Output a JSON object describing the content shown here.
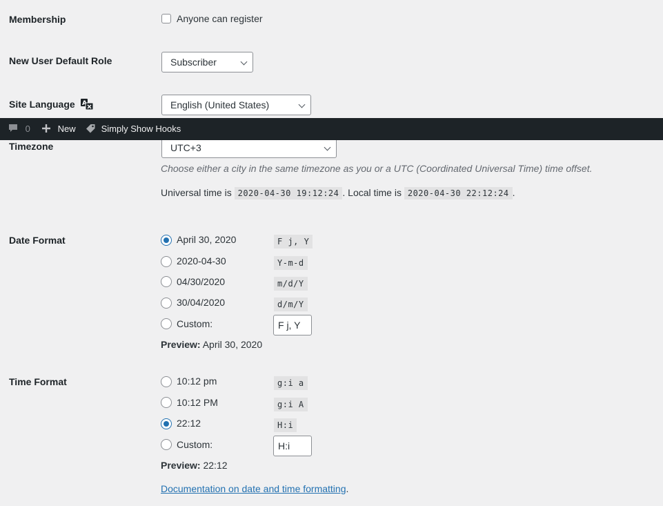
{
  "membership": {
    "label": "Membership",
    "checkbox_label": "Anyone can register",
    "checked": false
  },
  "default_role": {
    "label": "New User Default Role",
    "value": "Subscriber"
  },
  "site_language": {
    "label": "Site Language",
    "value": "English (United States)",
    "icon": "translation-icon"
  },
  "admin_bar": {
    "comments_count": "0",
    "new_label": "New",
    "plugin_label": "Simply Show Hooks",
    "icons": [
      "comment-icon",
      "plus-icon",
      "tag-icon"
    ]
  },
  "timezone": {
    "label": "Timezone",
    "value": "UTC+3",
    "description": "Choose either a city in the same timezone as you or a UTC (Coordinated Universal Time) time offset.",
    "universal_prefix": "Universal time is",
    "universal_value": "2020-04-30 19:12:24",
    "local_prefix": ". Local time is",
    "local_value": "2020-04-30 22:12:24",
    "suffix": "."
  },
  "date_format": {
    "label": "Date Format",
    "options": [
      {
        "label": "April 30, 2020",
        "code": "F j, Y",
        "checked": true
      },
      {
        "label": "2020-04-30",
        "code": "Y-m-d",
        "checked": false
      },
      {
        "label": "04/30/2020",
        "code": "m/d/Y",
        "checked": false
      },
      {
        "label": "30/04/2020",
        "code": "d/m/Y",
        "checked": false
      }
    ],
    "custom_label": "Custom:",
    "custom_value": "F j, Y",
    "preview_label": "Preview:",
    "preview_value": "April 30, 2020"
  },
  "time_format": {
    "label": "Time Format",
    "options": [
      {
        "label": "10:12 pm",
        "code": "g:i a",
        "checked": false
      },
      {
        "label": "10:12 PM",
        "code": "g:i A",
        "checked": false
      },
      {
        "label": "22:12",
        "code": "H:i",
        "checked": true
      }
    ],
    "custom_label": "Custom:",
    "custom_value": "H:i",
    "preview_label": "Preview:",
    "preview_value": "22:12"
  },
  "doc_link": {
    "text": "Documentation on date and time formatting",
    "suffix": "."
  },
  "colors": {
    "accent": "#2271b1",
    "admin_bar": "#1d2327",
    "background": "#f0f0f1"
  }
}
